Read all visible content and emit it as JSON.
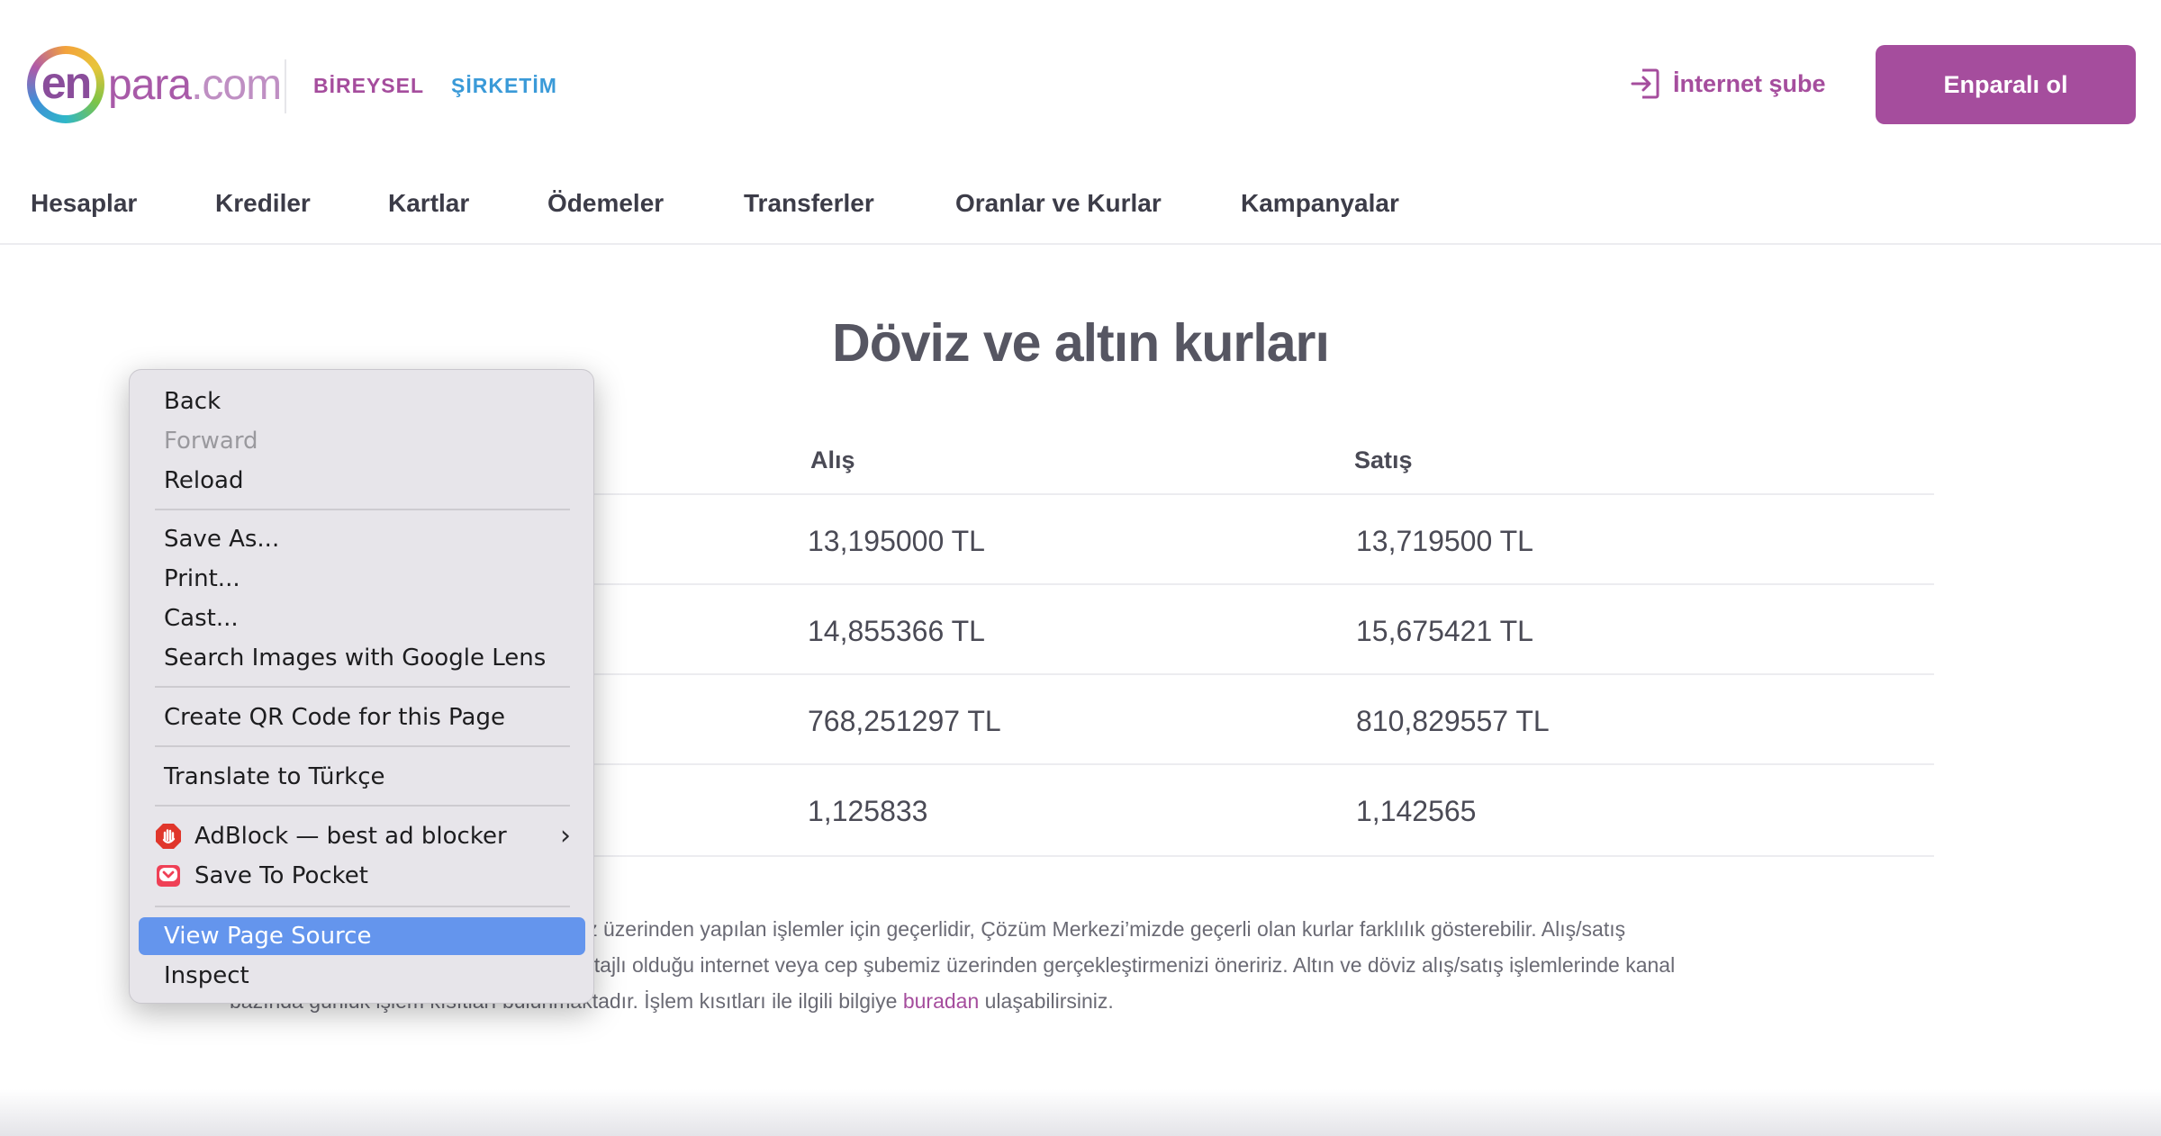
{
  "header": {
    "logo": {
      "en": "en",
      "word": "para",
      "domain": ".com"
    },
    "segments": [
      "BİREYSEL",
      "ŞİRKETİM"
    ],
    "internet_branch": "İnternet şube",
    "cta": "Enparalı ol"
  },
  "nav": [
    "Hesaplar",
    "Krediler",
    "Kartlar",
    "Ödemeler",
    "Transferler",
    "Oranlar ve Kurlar",
    "Kampanyalar"
  ],
  "main": {
    "title": "Döviz ve altın kurları",
    "columns": {
      "buy": "Alış",
      "sell": "Satış"
    },
    "rows": [
      {
        "buy": "13,195000 TL",
        "sell": "13,719500 TL"
      },
      {
        "buy": "14,855366 TL",
        "sell": "15,675421 TL"
      },
      {
        "buy": "768,251297 TL",
        "sell": "810,829557 TL"
      },
      {
        "buy": "1,125833",
        "sell": "1,142565"
      }
    ],
    "note": {
      "line1": "iz üzerinden yapılan işlemler için geçerlidir, Çözüm Merkezi’mizde geçerli olan kurlar farklılık gösterebilir. Alış/satış",
      "line2": "ntajlı olduğu internet veya cep şubemiz üzerinden gerçekleştirmenizi öneririz. Altın ve döviz alış/satış işlemlerinde kanal",
      "line3_pre": "bazında günlük işlem kısıtları bulunmaktadır. İşlem kısıtları ile ilgili bilgiye ",
      "link": "buradan",
      "line3_post": " ulaşabilirsiniz."
    }
  },
  "context_menu": {
    "back": "Back",
    "forward": "Forward",
    "reload": "Reload",
    "save_as": "Save As...",
    "print": "Print...",
    "cast": "Cast...",
    "search_lens": "Search Images with Google Lens",
    "qr_code": "Create QR Code for this Page",
    "translate": "Translate to Türkçe",
    "adblock": "AdBlock — best ad blocker",
    "pocket": "Save To Pocket",
    "view_source": "View Page Source",
    "inspect": "Inspect"
  },
  "colors": {
    "brand_purple": "#a54d9d",
    "brand_blue": "#3a9ad8",
    "menu_highlight": "#6495ed"
  }
}
